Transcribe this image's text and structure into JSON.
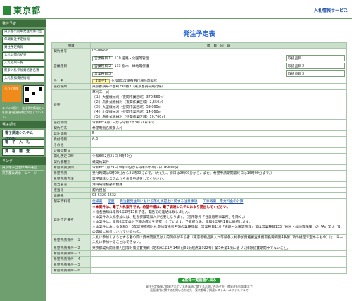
{
  "header": {
    "logo": "東京都",
    "right_link": "入札情報サービス"
  },
  "sidebar": {
    "section_title": "発注予定",
    "menu": [
      "東京都公開中発注案件公告",
      "年間発注予定情報",
      "発注予定情報",
      "入札公開の結果",
      "入札結果一覧",
      "競争入札参加資格者名簿",
      "入札参加資格情報"
    ],
    "mobile_badge": "モバイル版",
    "note": "モバイル版は、発注予定情報と入札(見積)経過情報に対応しています。",
    "system_title": "電子調達",
    "system_buttons": [
      "電子調達システム(TOP)",
      "電　子　入　札",
      "資　格　審　査"
    ],
    "links_title": "リンク",
    "links": [
      "東京電子自治体共同運営",
      "東京都公式ホームページ"
    ]
  },
  "main": {
    "title": "発注予定表",
    "col_headers": [
      "項目",
      "項　目　内　容"
    ],
    "back_button": "◆案件一覧画面へ戻る"
  },
  "table": {
    "contract_no": {
      "label": "契約番号",
      "value": "05-00498"
    },
    "business": {
      "label": "営業種目",
      "items": [
        {
          "name": "営業種目１",
          "value": "110 道路・公園等管理",
          "qual": "取扱品目１"
        },
        {
          "name": "営業種目２",
          "value": "133 樹木・緑地等保護",
          "qual": "取扱品目２"
        },
        {
          "name": "営業種目３",
          "value": "",
          "qual": "取扱品目３"
        }
      ]
    },
    "work_name": {
      "label": "件　名",
      "tag": "【電子】",
      "value": "令和6年度調布飛行場除草委託"
    },
    "location": {
      "label": "履行場所",
      "value": "東京都調布市西町290番3（東京都調布飛行場）"
    },
    "summary": {
      "label": "概要",
      "lines": [
        "草刈工一式",
        "（１）大型機械刈（夜間作業区域）370,560㎡",
        "（２）肩掛式機械刈（夜間作業区域）2,550㎡",
        "（３）大型機械刈（昼間作業区域）59,060㎡",
        "（４）小型機械刈（昼間作業区域）14,060㎡",
        "（５）肩掛式機械刈（昼間作業区域）10,760㎡"
      ]
    },
    "rows": [
      {
        "label": "履行期間",
        "value": "令和6年4月1日から令和7年3月21日まで"
      },
      {
        "label": "契約方法",
        "value": "希望制指名競争入札"
      },
      {
        "label": "発注等級",
        "value": "B"
      },
      {
        "label": "受付等級",
        "value": "A,B"
      },
      {
        "label": "その他",
        "value": ""
      },
      {
        "label": "公報登載日",
        "value": ""
      },
      {
        "label": "開札予定日時",
        "value": "令和6年2月21日 9時40分"
      },
      {
        "label": "契約書種別",
        "value": "紙契約案件"
      },
      {
        "label": "希望申請期間",
        "value": "令和6年1月29日 9時00分から令和6年2月2日 16時00分"
      },
      {
        "label": "希望申請",
        "value": "受付時間は9時00分から21時00分まで。（ただし、初日は9時00分から、また、希望申請期間最終日は16時00分まで。）"
      },
      {
        "label": "希望申請方法",
        "value": "電子調達システムから希望申請をしてください。"
      },
      {
        "label": "担当部署",
        "value": "港湾局総務部財務課"
      },
      {
        "label": "担当係",
        "value": "契約担当"
      },
      {
        "label": "連絡先",
        "value": "03-5320-5532"
      }
    ],
    "docs": {
      "label": "配布資料等",
      "links": [
        "仕様書",
        "図面",
        "受注者発注時における落札後提出に関する注意事項",
        "工事概要・電力料金の計算"
      ]
    },
    "notes": {
      "label": "発注予定備考",
      "lines": [
        "＊本案件は、電子入札案件です。希望申請は、電子調達システムにより提出してください。",
        "＊指名通知は令和6年2月13日予定。電話での連絡は致しません。",
        "＊本案件の入札参加には、社会保険等加入が必要となります。（適用除外「任意適用事業所」を除く。）",
        "＊本案件は、令和6年度歳入予算の成立を前提としています。予算成立後、令和6年4月1日に締結します。",
        "＊本案件における令和5・6年度東京都入札参加資格者名簿の業種登録：営業種目110「道路・公園等管理」又は営業種目133「樹木・緑地等保護」の「A」又は「B」の等級に格付けされているもの。"
      ]
    },
    "extra": [
      {
        "label": "希望申請要件－１",
        "value": "入札に参加しようとする者の間に資本関係又は人的関係がある者（東京都物品買入れ等競争入札参加資格審査事務取扱要綱第4条第1項の規定で定めるもの）は、同一入札に参加することはできない。"
      },
      {
        "label": "希望申請要件－２",
        "value": "東京都契約関係暴力団等対策措置要綱（昭和62年1月14日付61財経庶第922号）第5条第1項に基づく排除措置期間中でないこと。"
      },
      {
        "label": "希望申請要件－３",
        "value": ""
      },
      {
        "label": "希望申請要件－４",
        "value": ""
      },
      {
        "label": "希望申請要件－５",
        "value": ""
      },
      {
        "label": "希望申請要件－６",
        "value": ""
      }
    ]
  },
  "footer": {
    "line1": "発注予定情報に掲載されている各事項に関するお問い合わせ先　各発注担当部署まで",
    "line2": "画面操作に関するお問い合わせ先　東京都電子調達システムヘルプデスクまで"
  }
}
